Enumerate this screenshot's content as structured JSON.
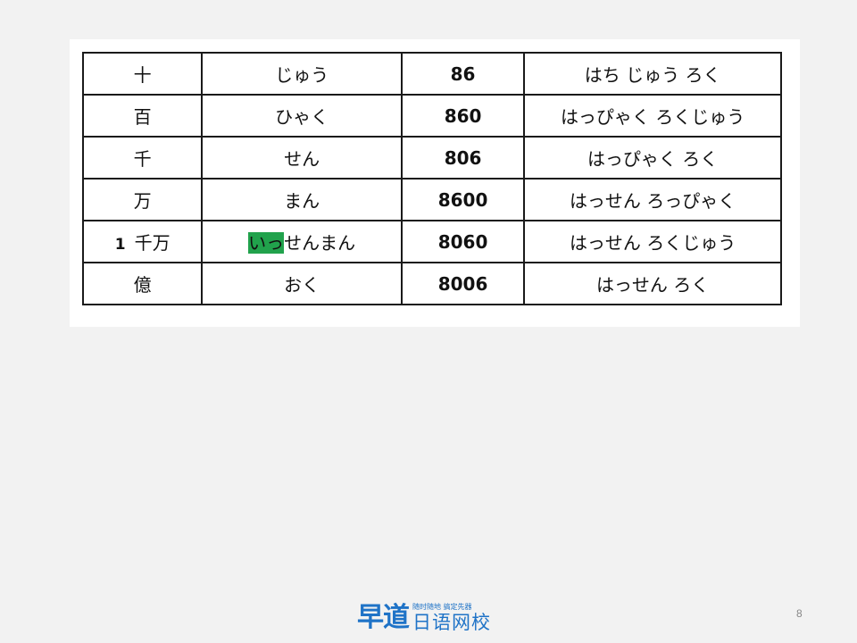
{
  "table": {
    "rows": [
      {
        "kanji": "十",
        "reading": "じゅう",
        "number": "86",
        "number_reading": "はち じゅう ろく"
      },
      {
        "kanji": "百",
        "reading": "ひゃく",
        "number": "860",
        "number_reading": "はっぴゃく ろくじゅう"
      },
      {
        "kanji": "千",
        "reading": "せん",
        "number": "806",
        "number_reading": "はっぴゃく ろく"
      },
      {
        "kanji": "万",
        "reading": "まん",
        "number": "8600",
        "number_reading": "はっせん ろっぴゃく"
      },
      {
        "kanji_prefix": "1",
        "kanji": "千万",
        "reading_highlight": "いっ",
        "reading": "せんまん",
        "number": "8060",
        "number_reading": "はっせん ろくじゅう"
      },
      {
        "kanji": "億",
        "reading": "おく",
        "number": "8006",
        "number_reading": "はっせん ろく"
      }
    ],
    "highlight_color": "#21a24c"
  },
  "footer": {
    "logo_mark": "早道",
    "logo_slogan": "随时随地 搞定先器",
    "logo_school": "日语网校",
    "page_number": "8"
  }
}
